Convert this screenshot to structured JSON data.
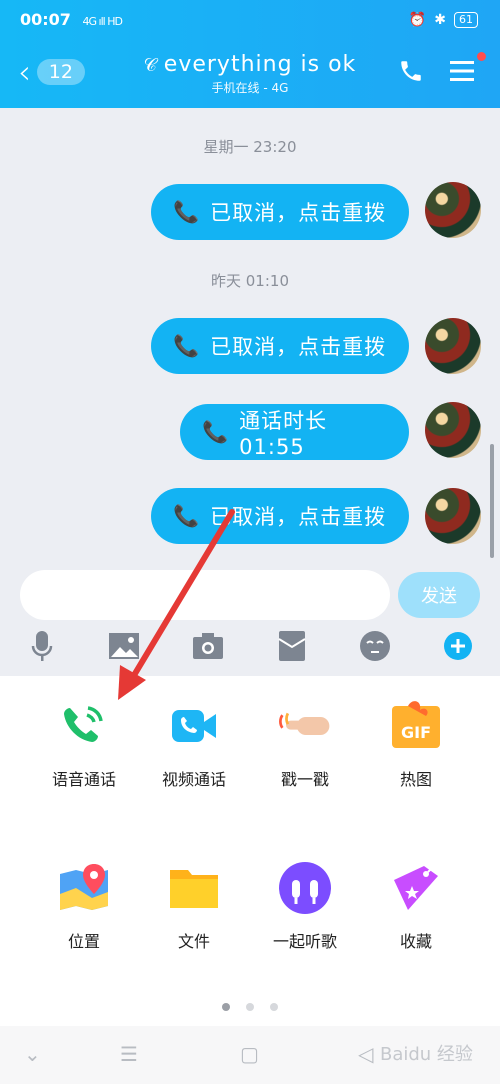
{
  "status_bar": {
    "time": "00:07",
    "network": "4G ıll HD",
    "battery": "61"
  },
  "header": {
    "badge": "12",
    "title": "everything is ok",
    "subtitle": "手机在线 - 4G"
  },
  "messages": [
    {
      "time_label": "星期一 23:20"
    },
    {
      "text": "已取消，点击重拨"
    },
    {
      "time_label": "昨天 01:10"
    },
    {
      "text": "已取消，点击重拨"
    },
    {
      "text": "通话时长 01:55"
    },
    {
      "text": "已取消，点击重拨"
    }
  ],
  "input": {
    "placeholder": "",
    "send_label": "发送"
  },
  "toolbar": [
    "mic-icon",
    "image-icon",
    "camera-icon",
    "red-packet-icon",
    "emoji-icon",
    "plus-icon"
  ],
  "panel": {
    "items": [
      {
        "label": "语音通话",
        "icon": "voice-call-icon"
      },
      {
        "label": "视频通话",
        "icon": "video-call-icon"
      },
      {
        "label": "戳一戳",
        "icon": "poke-icon"
      },
      {
        "label": "热图",
        "icon": "gif-icon"
      },
      {
        "label": "位置",
        "icon": "location-icon"
      },
      {
        "label": "文件",
        "icon": "folder-icon"
      },
      {
        "label": "一起听歌",
        "icon": "headphones-icon"
      },
      {
        "label": "收藏",
        "icon": "favorite-icon"
      }
    ],
    "page": 1,
    "pages": 3
  },
  "watermark": "Baidu 经验",
  "colors": {
    "accent": "#13b3f3",
    "arrow": "#e53935"
  }
}
